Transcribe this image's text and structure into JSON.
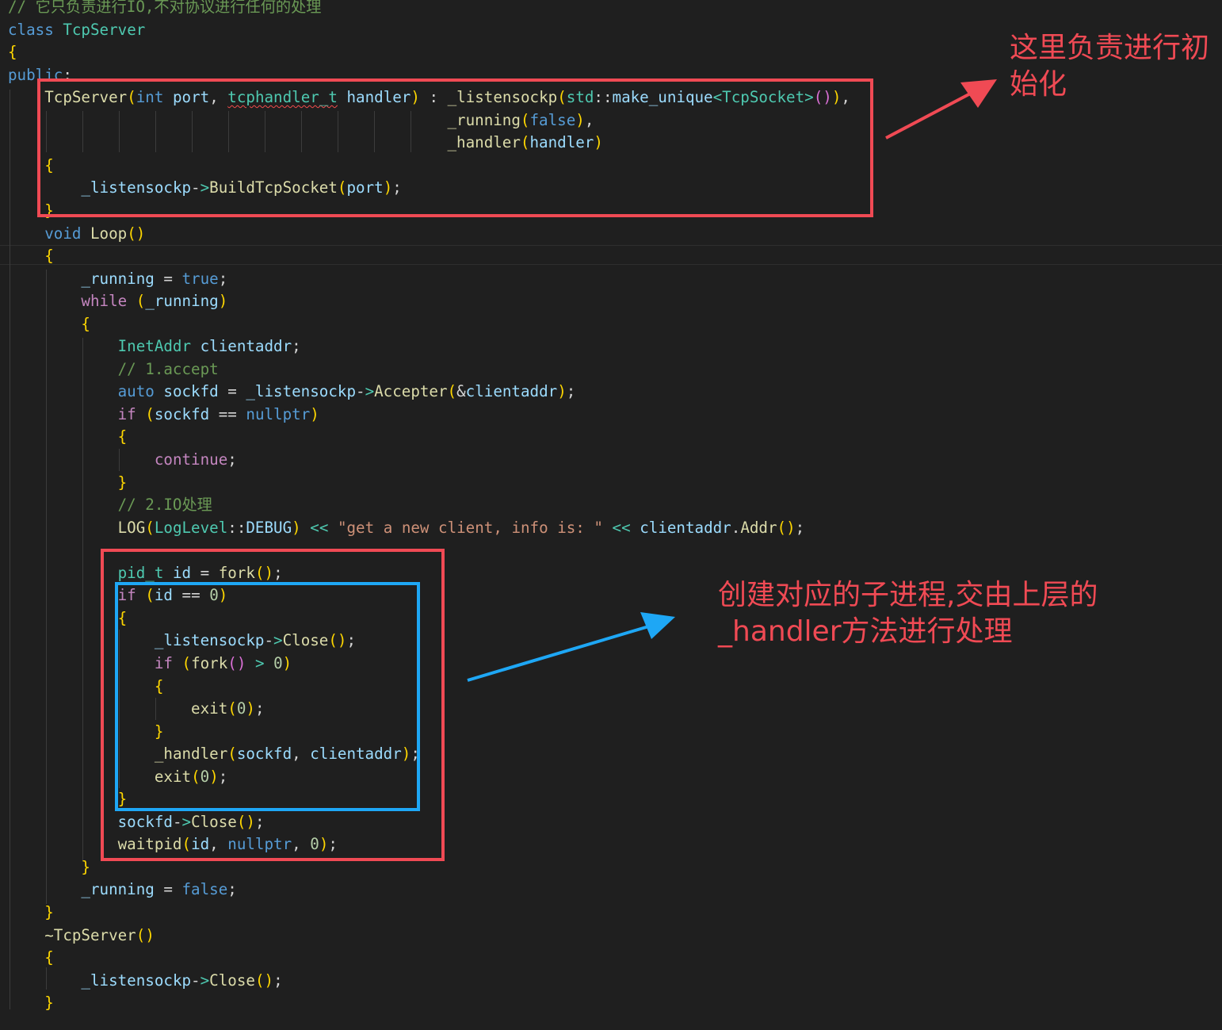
{
  "code_lines": [
    "// 它只负责进行IO,不对协议进行任何的处理",
    "class TcpServer",
    "{",
    "public:",
    "    TcpServer(int port, tcphandler_t handler) : _listensockp(std::make_unique<TcpSocket>()),",
    "                                                _running(false),",
    "                                                _handler(handler)",
    "    {",
    "        _listensockp->BuildTcpSocket(port);",
    "    }",
    "    void Loop()",
    "    {",
    "        _running = true;",
    "        while (_running)",
    "        {",
    "            InetAddr clientaddr;",
    "            // 1.accept",
    "            auto sockfd = _listensockp->Accepter(&clientaddr);",
    "            if (sockfd == nullptr)",
    "            {",
    "                continue;",
    "            }",
    "            // 2.IO处理",
    "            LOG(LogLevel::DEBUG) << \"get a new client, info is: \" << clientaddr.Addr();",
    "",
    "            pid_t id = fork();",
    "            if (id == 0)",
    "            {",
    "                _listensockp->Close();",
    "                if (fork() > 0)",
    "                {",
    "                    exit(0);",
    "                }",
    "                _handler(sockfd, clientaddr);",
    "                exit(0);",
    "            }",
    "            sockfd->Close();",
    "            waitpid(id, nullptr, 0);",
    "        }",
    "        _running = false;",
    "    }",
    "    ~TcpServer()",
    "    {",
    "        _listensockp->Close();",
    "    }"
  ],
  "annotations": {
    "init_note": [
      "这里负责进行初",
      "始化"
    ],
    "child_process_note": [
      "创建对应的子进程,交由上层的",
      "_handler方法进行处理"
    ]
  },
  "colors": {
    "background": "#1f1f1f",
    "red_annotation": "#f04a54",
    "blue_annotation": "#1ea7f5",
    "comment": "#6a9955",
    "keyword": "#569cd6",
    "type": "#4ec9b0",
    "function": "#dcdcaa",
    "variable": "#9cdcfe"
  }
}
